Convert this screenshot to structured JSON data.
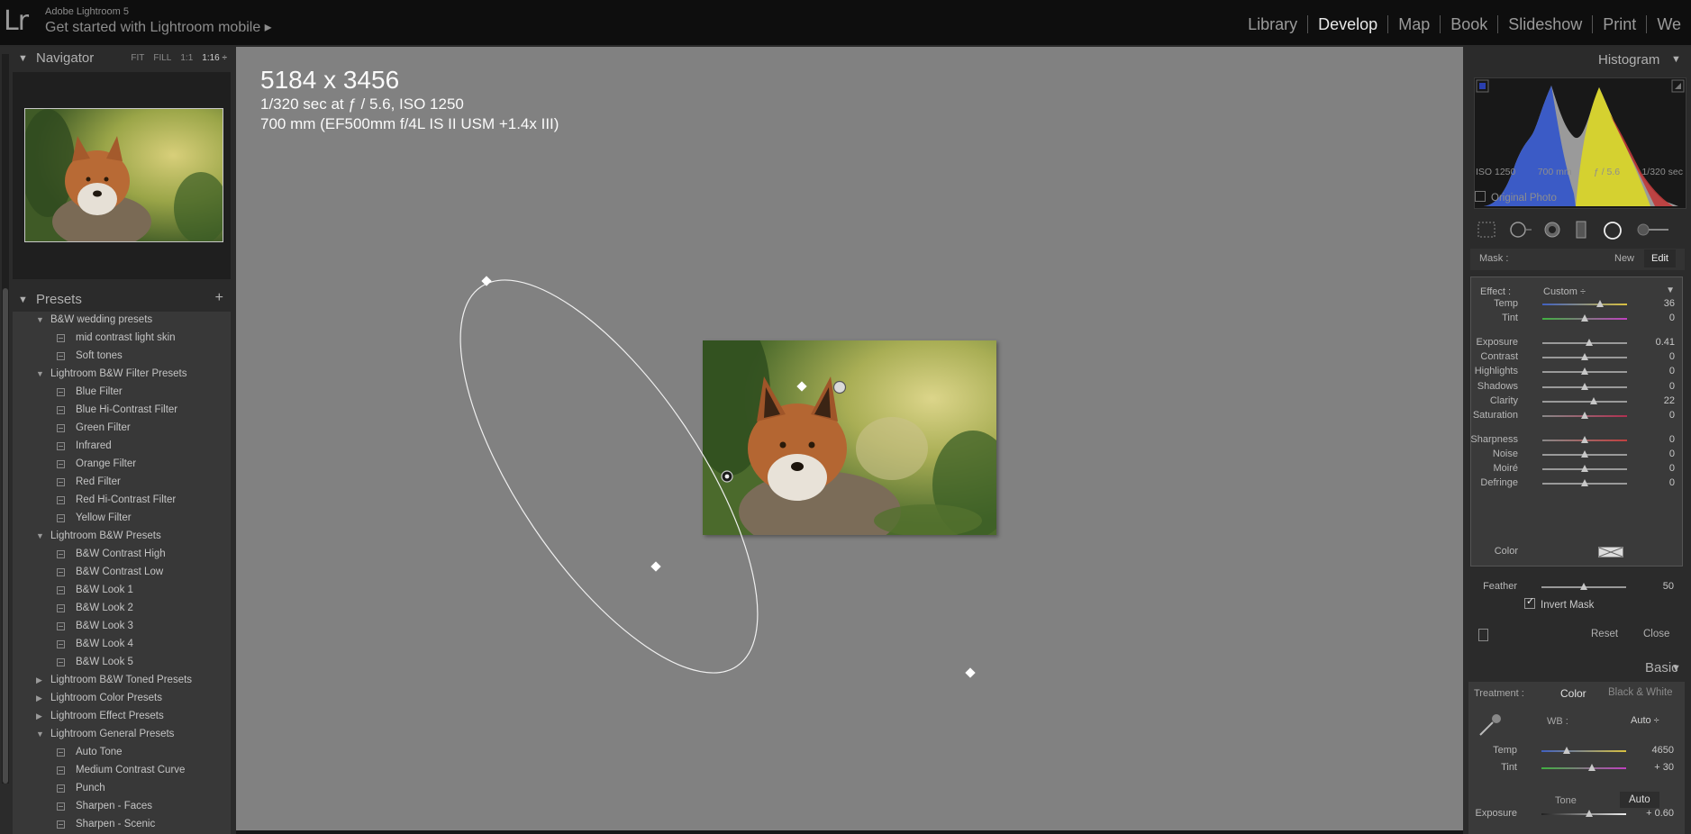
{
  "app": {
    "logo": "Lr",
    "name": "Adobe Lightroom 5",
    "get_started": "Get started with Lightroom mobile ▸"
  },
  "modules": [
    "Library",
    "Develop",
    "Map",
    "Book",
    "Slideshow",
    "Print",
    "We"
  ],
  "active_module": "Develop",
  "navigator": {
    "title": "Navigator",
    "opts": [
      "FIT",
      "FILL",
      "1:1",
      "1:16 ÷"
    ],
    "selected": "1:16 ÷"
  },
  "presets": {
    "title": "Presets",
    "add_icon": "+",
    "rows": [
      {
        "type": "folder",
        "expanded": true,
        "label": "B&W wedding presets"
      },
      {
        "type": "item",
        "label": "mid contrast light skin"
      },
      {
        "type": "item",
        "label": "Soft tones"
      },
      {
        "type": "folder",
        "expanded": true,
        "label": "Lightroom B&W Filter Presets"
      },
      {
        "type": "item",
        "label": "Blue Filter"
      },
      {
        "type": "item",
        "label": "Blue Hi-Contrast Filter"
      },
      {
        "type": "item",
        "label": "Green Filter"
      },
      {
        "type": "item",
        "label": "Infrared"
      },
      {
        "type": "item",
        "label": "Orange Filter"
      },
      {
        "type": "item",
        "label": "Red Filter"
      },
      {
        "type": "item",
        "label": "Red Hi-Contrast Filter"
      },
      {
        "type": "item",
        "label": "Yellow Filter"
      },
      {
        "type": "folder",
        "expanded": true,
        "label": "Lightroom B&W Presets"
      },
      {
        "type": "item",
        "label": "B&W Contrast High"
      },
      {
        "type": "item",
        "label": "B&W Contrast Low"
      },
      {
        "type": "item",
        "label": "B&W Look 1"
      },
      {
        "type": "item",
        "label": "B&W Look 2"
      },
      {
        "type": "item",
        "label": "B&W Look 3"
      },
      {
        "type": "item",
        "label": "B&W Look 4"
      },
      {
        "type": "item",
        "label": "B&W Look 5"
      },
      {
        "type": "folder",
        "expanded": false,
        "label": "Lightroom B&W Toned Presets"
      },
      {
        "type": "folder",
        "expanded": false,
        "label": "Lightroom Color Presets"
      },
      {
        "type": "folder",
        "expanded": false,
        "label": "Lightroom Effect Presets"
      },
      {
        "type": "folder",
        "expanded": true,
        "label": "Lightroom General Presets"
      },
      {
        "type": "item",
        "label": "Auto Tone"
      },
      {
        "type": "item",
        "label": "Medium Contrast Curve"
      },
      {
        "type": "item",
        "label": "Punch"
      },
      {
        "type": "item",
        "label": "Sharpen - Faces"
      },
      {
        "type": "item",
        "label": "Sharpen - Scenic"
      }
    ]
  },
  "photo_info": {
    "dimensions": "5184 x 3456",
    "exposure": "1/320 sec at ƒ / 5.6, ISO 1250",
    "lens": "700 mm (EF500mm f/4L IS II USM +1.4x III)"
  },
  "histogram": {
    "title": "Histogram",
    "iso": "ISO 1250",
    "focal": "700 mm",
    "aperture": "ƒ / 5.6",
    "shutter": "1/320 sec",
    "original_photo": "Original Photo"
  },
  "tool_icons": [
    "crop-overlay-icon",
    "spot-removal-icon",
    "red-eye-icon",
    "graduated-filter-icon",
    "radial-filter-icon",
    "adjustment-brush-icon"
  ],
  "mask": {
    "label": "Mask :",
    "new": "New",
    "edit": "Edit"
  },
  "effect": {
    "label": "Effect :",
    "value": "Custom ÷"
  },
  "radial_sliders": [
    {
      "label": "Temp",
      "value": "36",
      "pos": 0.68,
      "track": "temp"
    },
    {
      "label": "Tint",
      "value": "0",
      "pos": 0.5,
      "track": "tint"
    },
    {
      "label": "Exposure",
      "value": "0.41",
      "pos": 0.55,
      "track": "gray"
    },
    {
      "label": "Contrast",
      "value": "0",
      "pos": 0.5,
      "track": "gray"
    },
    {
      "label": "Highlights",
      "value": "0",
      "pos": 0.5,
      "track": "gray"
    },
    {
      "label": "Shadows",
      "value": "0",
      "pos": 0.5,
      "track": "gray"
    },
    {
      "label": "Clarity",
      "value": "22",
      "pos": 0.61,
      "track": "gray"
    },
    {
      "label": "Saturation",
      "value": "0",
      "pos": 0.5,
      "track": "sat"
    },
    {
      "label": "Sharpness",
      "value": "0",
      "pos": 0.5,
      "track": "sharp"
    },
    {
      "label": "Noise",
      "value": "0",
      "pos": 0.5,
      "track": "gray"
    },
    {
      "label": "Moiré",
      "value": "0",
      "pos": 0.5,
      "track": "gray"
    },
    {
      "label": "Defringe",
      "value": "0",
      "pos": 0.5,
      "track": "gray"
    }
  ],
  "color_label": "Color",
  "feather": {
    "label": "Feather",
    "value": "50",
    "pos": 0.5
  },
  "invert_mask": {
    "label": "Invert Mask",
    "checked": true
  },
  "reset": "Reset",
  "close": "Close",
  "basic": {
    "title": "Basic",
    "treatment_label": "Treatment :",
    "color": "Color",
    "bw": "Black & White",
    "wb_label": "WB :",
    "wb_value": "Auto ÷",
    "temp": {
      "label": "Temp",
      "value": "4650",
      "pos": 0.3
    },
    "tint": {
      "label": "Tint",
      "value": "+ 30",
      "pos": 0.6
    },
    "tone": "Tone",
    "auto": "Auto",
    "exposure": {
      "label": "Exposure",
      "value": "+ 0.60",
      "pos": 0.56
    }
  },
  "colors": {
    "accent": "#e8e8e8",
    "panel": "#2b2b2b",
    "canvas": "#818181"
  }
}
